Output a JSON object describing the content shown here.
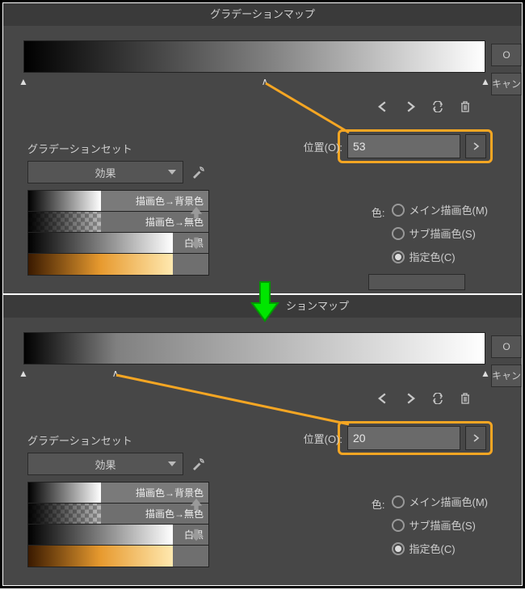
{
  "top": {
    "title": "グラデーションマップ",
    "buttons": {
      "ok": "O",
      "cancel": "キャン"
    },
    "position": {
      "label": "位置(O):",
      "value": "53"
    },
    "gset": {
      "title": "グラデーションセット",
      "dropdown": "効果",
      "items": [
        {
          "label": "描画色→背景色"
        },
        {
          "label": "描画色→無色"
        },
        {
          "label": "白黒"
        },
        {
          "label": ""
        }
      ]
    },
    "color": {
      "label": "色:",
      "opts": [
        {
          "label": "メイン描画色(M)",
          "checked": false
        },
        {
          "label": "サブ描画色(S)",
          "checked": false
        },
        {
          "label": "指定色(C)",
          "checked": true
        }
      ]
    }
  },
  "bottom": {
    "title": "ションマップ",
    "buttons": {
      "ok": "O",
      "cancel": "キャン"
    },
    "position": {
      "label": "位置(O):",
      "value": "20"
    },
    "gset": {
      "title": "グラデーションセット",
      "dropdown": "効果",
      "items": [
        {
          "label": "描画色→背景色"
        },
        {
          "label": "描画色→無色"
        },
        {
          "label": "白黒"
        },
        {
          "label": ""
        }
      ]
    },
    "color": {
      "label": "色:",
      "opts": [
        {
          "label": "メイン描画色(M)",
          "checked": false
        },
        {
          "label": "サブ描画色(S)",
          "checked": false
        },
        {
          "label": "指定色(C)",
          "checked": true
        }
      ]
    }
  }
}
